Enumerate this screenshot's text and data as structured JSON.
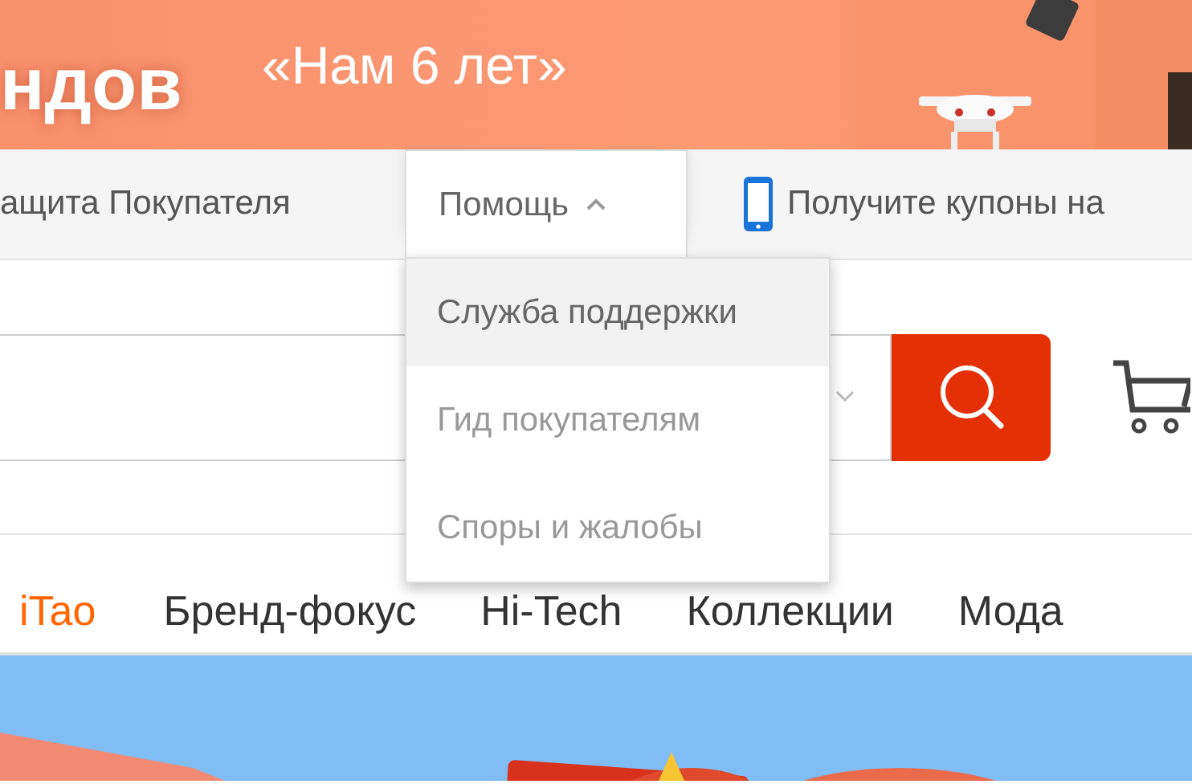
{
  "banner": {
    "left_text": "ндов",
    "headline": "«Нам 6 лет»"
  },
  "top_bar": {
    "items": [
      {
        "kind": "link",
        "label": "ащита Покупателя"
      },
      {
        "kind": "dropdown",
        "label": "Помощь",
        "expanded": true
      },
      {
        "kind": "phone",
        "label": "Получите купоны на"
      }
    ]
  },
  "help_menu": {
    "items": [
      {
        "label": "Служба поддержки",
        "selected": true
      },
      {
        "label": "Гид покупателям",
        "selected": false
      },
      {
        "label": "Споры и жалобы",
        "selected": false
      }
    ]
  },
  "nav": {
    "items": [
      {
        "label": "iTao",
        "highlighted": true
      },
      {
        "label": "Бренд-фокус",
        "highlighted": false
      },
      {
        "label": "Hi-Tech",
        "highlighted": false
      },
      {
        "label": "Коллекции",
        "highlighted": false
      },
      {
        "label": "Мода",
        "highlighted": false
      }
    ]
  }
}
